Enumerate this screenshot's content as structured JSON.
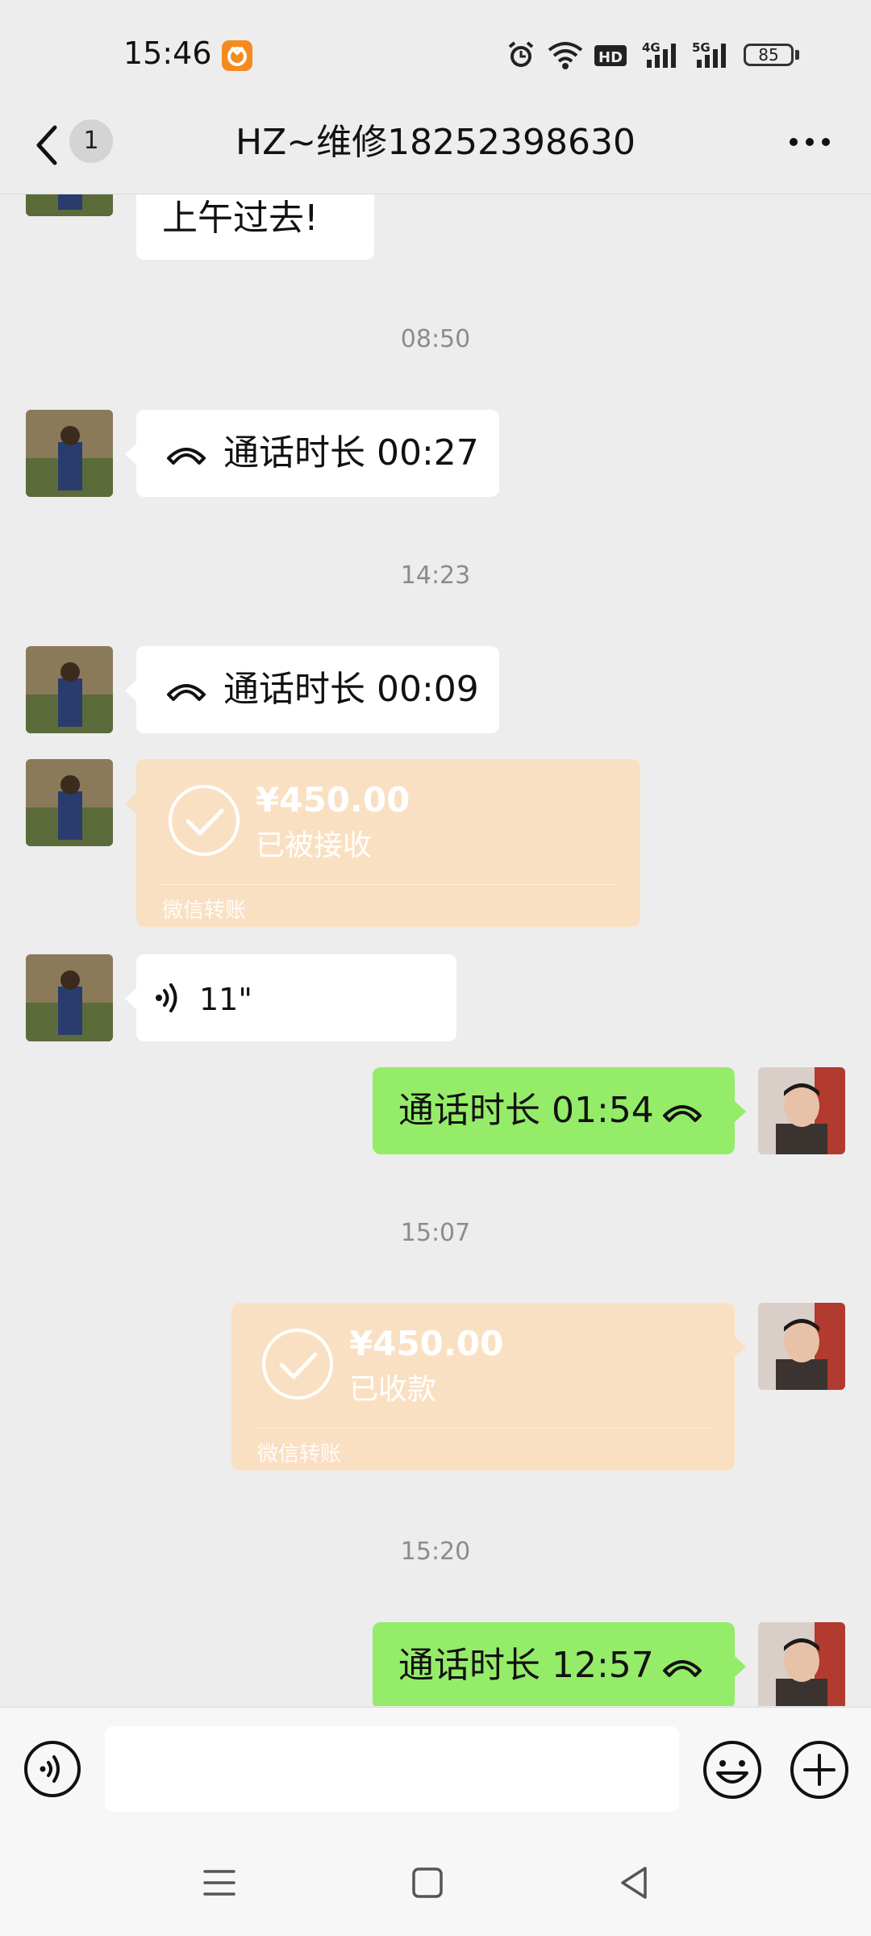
{
  "status_bar": {
    "time": "15:46",
    "battery": "85",
    "icons": [
      "alarm-icon",
      "wifi-icon",
      "hd-icon",
      "signal-4g-icon",
      "signal-5g-icon",
      "battery-icon"
    ]
  },
  "header": {
    "title": "HZ~维修18252398630",
    "unread_count": "1",
    "icons": [
      "back-icon",
      "more-icon"
    ]
  },
  "messages": {
    "m1": {
      "text": "上午过去!"
    },
    "t1": "08:50",
    "m2": {
      "text": "通话时长 00:27"
    },
    "t2": "14:23",
    "m3": {
      "text": "通话时长 00:09"
    },
    "m4": {
      "amount": "¥450.00",
      "status": "已被接收",
      "footer": "微信转账"
    },
    "m5": {
      "text": "11\""
    },
    "m6": {
      "text": "通话时长 01:54"
    },
    "t3": "15:07",
    "m7": {
      "amount": "¥450.00",
      "status": "已收款",
      "footer": "微信转账"
    },
    "t4": "15:20",
    "m8": {
      "text": "通话时长 12:57"
    }
  },
  "input_bar": {
    "placeholder": "",
    "icons": [
      "voice-icon",
      "emoji-icon",
      "plus-icon"
    ]
  },
  "system_nav": {
    "icons": [
      "menu-icon",
      "home-icon",
      "back-triangle-icon"
    ]
  },
  "colors": {
    "background": "#ededed",
    "bubble_green": "#95ec69",
    "bubble_white": "#ffffff",
    "transfer_orange": "#fae0c2",
    "timestamp": "#8c8c8c"
  }
}
